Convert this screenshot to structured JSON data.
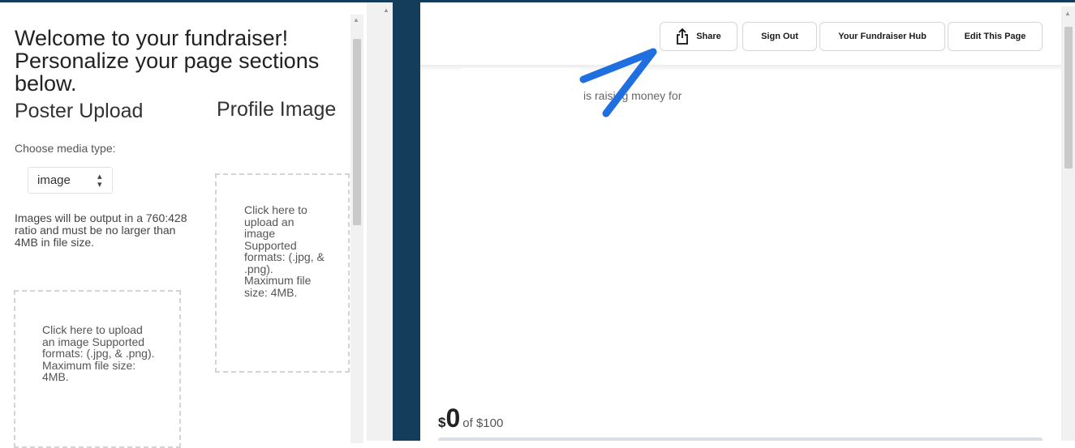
{
  "editor": {
    "welcome_text": "Welcome to your fundraiser! Personalize your page sections below.",
    "poster_title": "Poster Upload",
    "profile_title": "Profile Image",
    "media_type_label": "Choose media type:",
    "media_type_selected": "image",
    "media_note": "Images will be output in a 760:428 ratio and must be no larger than 4MB in file size.",
    "poster_dropzone_text": "Click here to upload an image Supported formats: (.jpg, & .png). Maximum file size: 4MB.",
    "profile_dropzone_text": "Click here to upload an image Supported formats: (.jpg, & .png). Maximum file size: 4MB."
  },
  "preview": {
    "buttons": {
      "share": "Share",
      "sign_out": "Sign Out",
      "hub": "Your Fundraiser Hub",
      "edit": "Edit This Page"
    },
    "raising_text": "is raising money for",
    "amount_currency": "$",
    "amount_raised": "0",
    "amount_goal": "of $100"
  },
  "colors": {
    "navy": "#143d5c",
    "annotation_arrow": "#1f6fe0"
  },
  "icons": {
    "share": "share-icon",
    "select_chevrons": "chevron-up-down-icon",
    "annotation": "arrow-annotation-icon"
  }
}
